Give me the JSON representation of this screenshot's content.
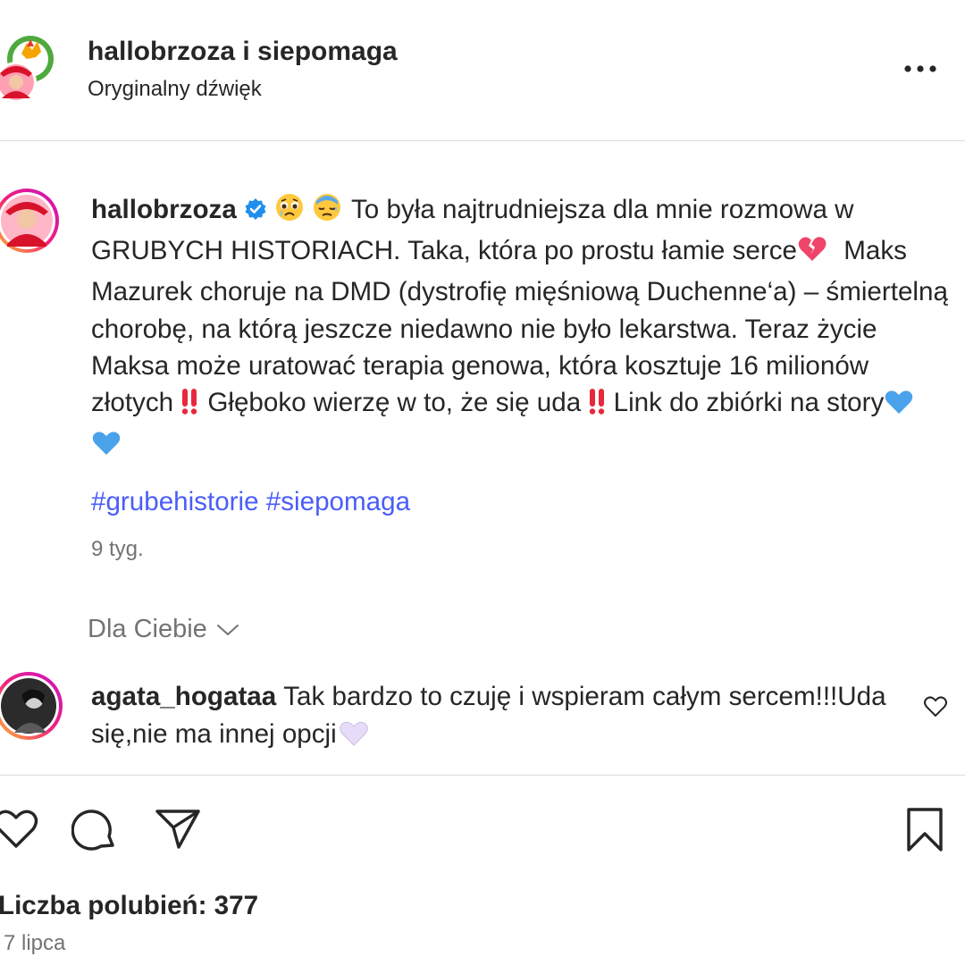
{
  "header": {
    "title": "hallobrzoza i siepomaga",
    "audio": "Oryginalny dźwięk"
  },
  "caption": {
    "username": "hallobrzoza",
    "text_1": "To była najtrudniejsza dla mnie rozmowa w GRUBYCH HISTORIACH. Taka, która po prostu łamie serce",
    "text_2": "Maks Mazurek choruje na DMD (dystrofię mięśniową Duchenne‘a) – śmiertelną chorobę, na którą jeszcze niedawno nie było lekarstwa. Teraz życie Maksa może uratować terapia genowa, która kosztuje 16 milionów złotych",
    "text_3": "Głęboko wierzę w to, że się uda",
    "text_4": "Link do zbiórki na story",
    "hashtags": [
      "#grubehistorie",
      "#siepomaga"
    ],
    "age": "9 tyg."
  },
  "comments_filter": {
    "label": "Dla Ciebie"
  },
  "comment": {
    "username": "agata_hogataa",
    "text": "Tak bardzo to czuję i wspieram całym sercem!!!Uda się,nie ma innej opcji"
  },
  "footer": {
    "likes": "Liczba polubień: 377",
    "date": "7 lipca"
  },
  "icons": {
    "verified": "verified-badge-icon",
    "like": "heart-icon",
    "comment": "comment-bubble-icon",
    "share": "paper-plane-icon",
    "save": "bookmark-icon",
    "more": "more-dots-icon",
    "chevron": "chevron-down-icon"
  },
  "colors": {
    "text": "#262626",
    "secondary": "#737373",
    "hashtag": "#4a5df9",
    "verified": "#1f8fee",
    "divider": "#dbdbdb"
  }
}
